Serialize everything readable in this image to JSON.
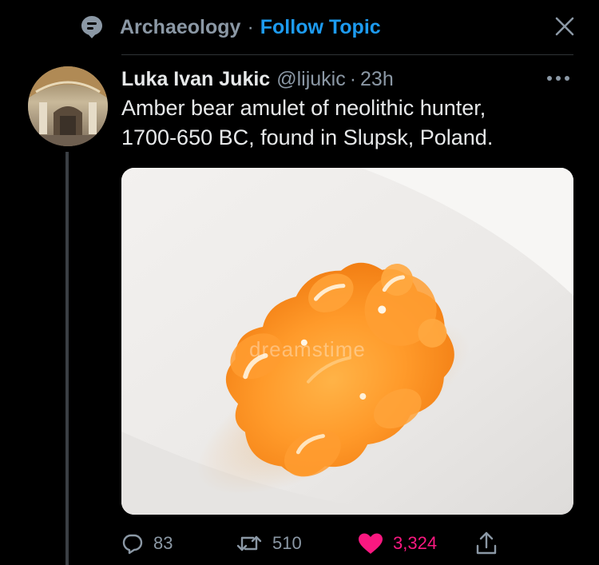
{
  "topic": {
    "name": "Archaeology",
    "separator": "·",
    "follow_label": "Follow Topic",
    "icon": "topic-bubble-icon",
    "close_icon": "close-icon"
  },
  "tweet": {
    "author_name": "Luka Ivan Jukic",
    "handle": "@lijukic",
    "separator": "·",
    "time": "23h",
    "text_lines": [
      "Amber bear amulet of neolithic hunter,",
      "1700-650 BC, found in Slupsk, Poland."
    ],
    "media": {
      "watermark": "dreamstime"
    },
    "more_icon": "more-horizontal-icon"
  },
  "actions": {
    "reply": {
      "icon": "reply-icon",
      "count": "83"
    },
    "retweet": {
      "icon": "retweet-icon",
      "count": "510"
    },
    "like": {
      "icon": "heart-icon",
      "count": "3,324",
      "liked": true
    },
    "share": {
      "icon": "share-icon"
    }
  },
  "colors": {
    "background": "#000000",
    "text_primary": "#e7e9ea",
    "text_secondary": "#8b98a5",
    "accent": "#1d9bf0",
    "like": "#f91880",
    "divider": "#2f3336"
  }
}
